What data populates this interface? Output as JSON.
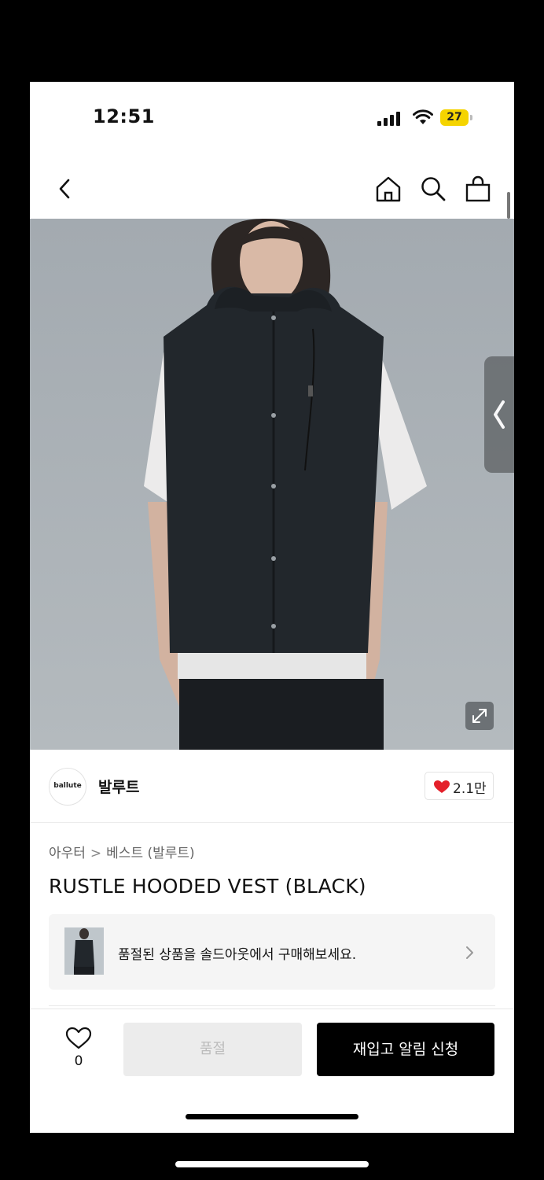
{
  "status_bar": {
    "time": "12:51",
    "battery": "27"
  },
  "nav": {
    "back_icon": "chevron-left-icon",
    "home_icon": "home-icon",
    "search_icon": "search-icon",
    "cart_icon": "shopping-bag-icon"
  },
  "hero": {
    "side_tab_icon": "chevron-left-icon",
    "expand_icon": "expand-icon"
  },
  "brand": {
    "logo_text": "ballute",
    "name": "발루트",
    "likes": "2.1만",
    "like_color": "#e4202a"
  },
  "product": {
    "breadcrumb": {
      "category": "아우터",
      "separator": ">",
      "subcategory": "베스트 (발루트)"
    },
    "title": "RUSTLE HOODED VEST (BLACK)"
  },
  "soldout_banner": {
    "text": "품절된 상품을 솔드아웃에서 구매해보세요.",
    "chevron_icon": "chevron-right-icon"
  },
  "bottom_bar": {
    "wishlist_count": "0",
    "soldout_label": "품절",
    "restock_label": "재입고 알림 신청"
  }
}
